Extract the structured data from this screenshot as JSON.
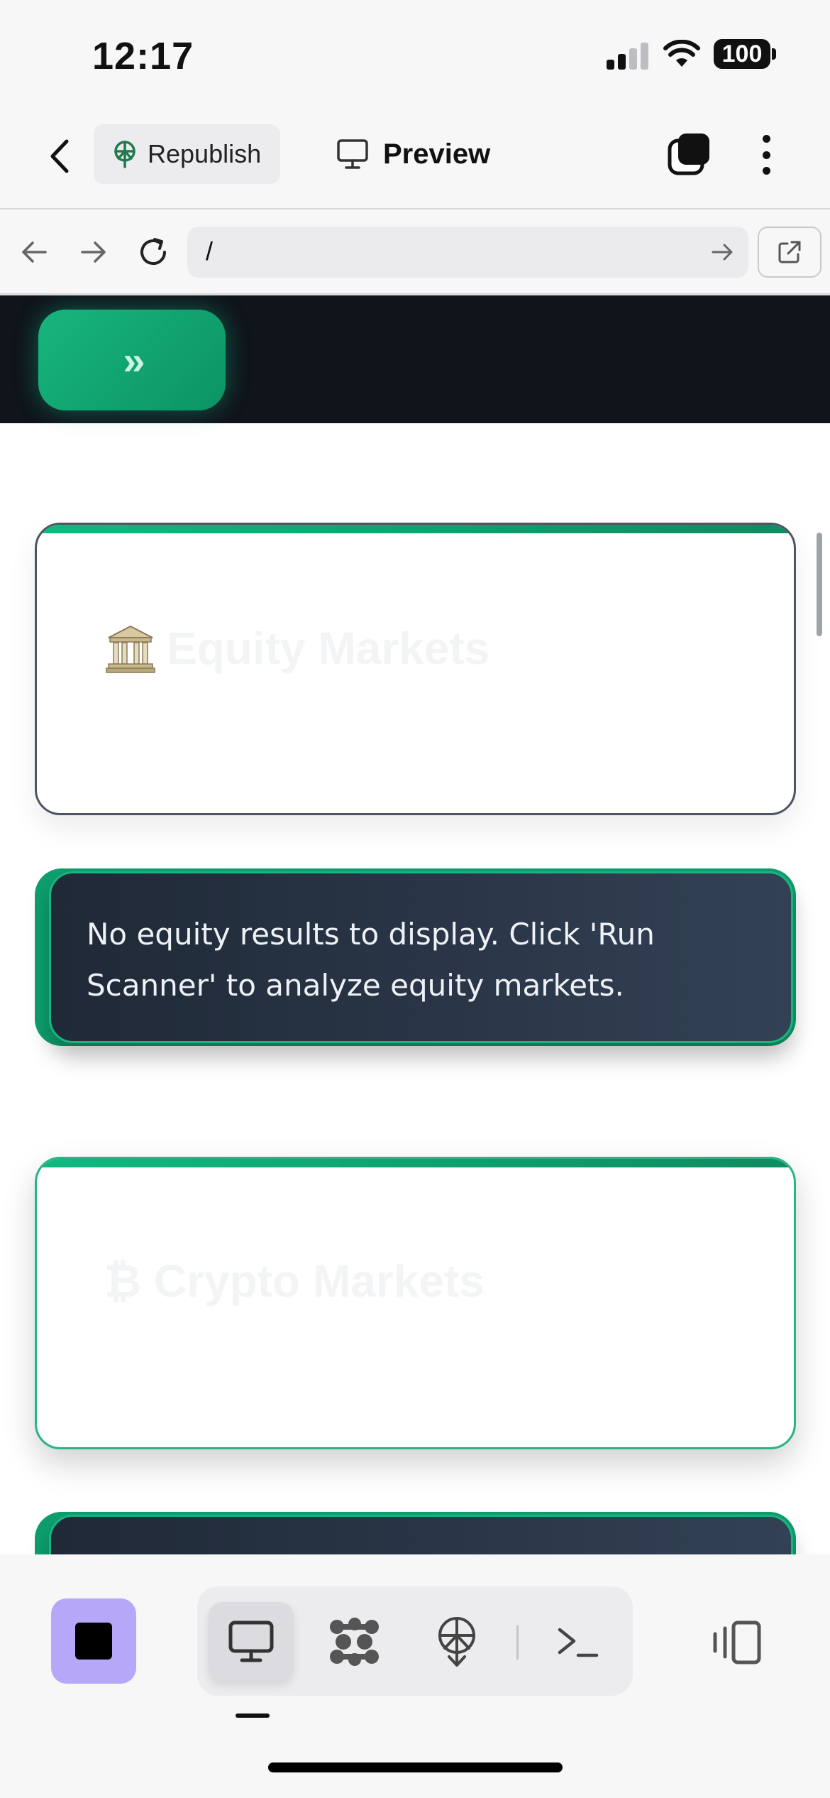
{
  "status_bar": {
    "time": "12:17",
    "battery": "100"
  },
  "toolbar": {
    "republish_label": "Republish",
    "preview_label": "Preview"
  },
  "browser": {
    "url": "/"
  },
  "content": {
    "expand_symbol": "»",
    "equity_section": {
      "title": "Equity Markets",
      "icon": "bank-icon"
    },
    "equity_message": "No equity results to display. Click 'Run Scanner' to analyze equity markets.",
    "crypto_section": {
      "title": "₿ Crypto Markets"
    }
  },
  "bottom_bar": {
    "tools": [
      "desktop-icon",
      "extensions-icon",
      "deploy-icon",
      "terminal-icon"
    ],
    "accent_color": "#b7a7f8"
  },
  "colors": {
    "brand_green": "#10b981",
    "dark_header": "#10141b",
    "message_bg": "#1f2937"
  }
}
